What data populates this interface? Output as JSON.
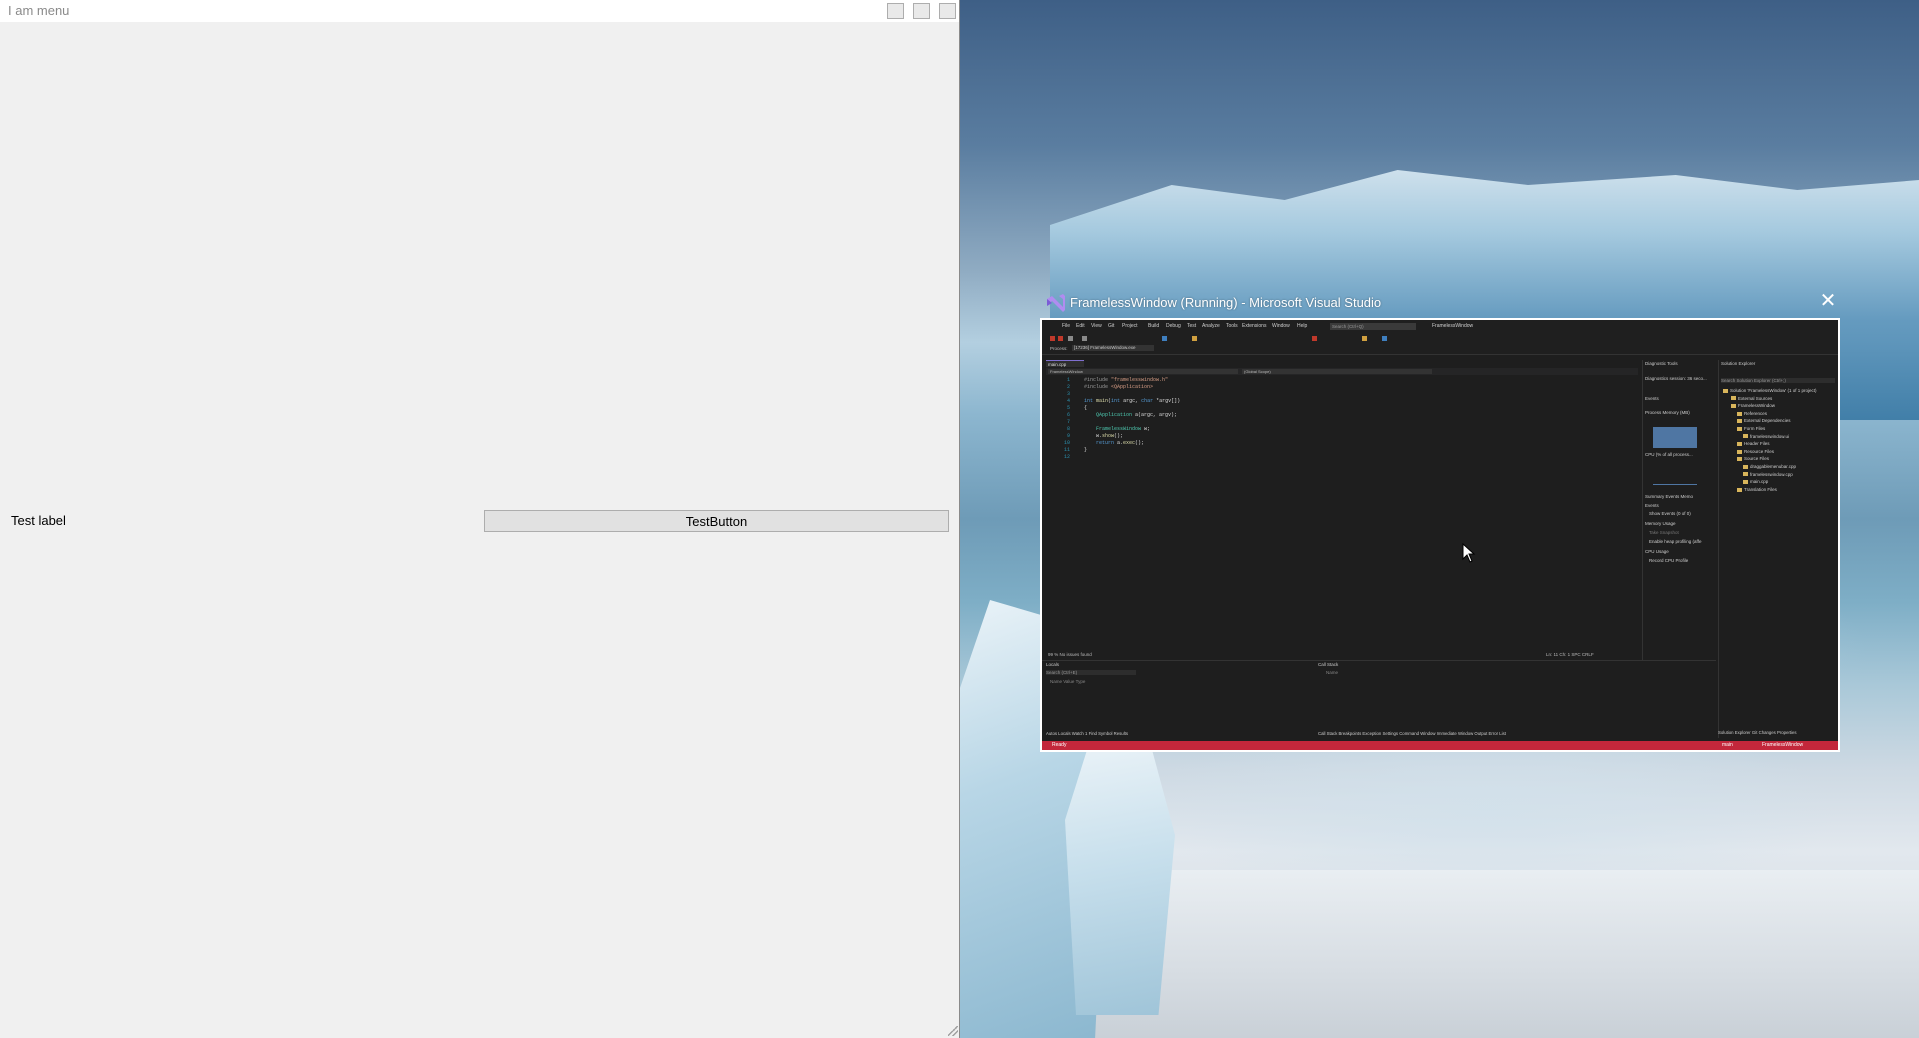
{
  "app_window": {
    "menu_title": "I am menu",
    "test_label": "Test label",
    "test_button_label": "TestButton"
  },
  "task_preview": {
    "title": "FramelessWindow (Running) - Microsoft Visual Studio",
    "close_symbol": "✕",
    "icon": "visual-studio-icon",
    "vs": {
      "menu": [
        "File",
        "Edit",
        "View",
        "Git",
        "Project",
        "Build",
        "Debug",
        "Test",
        "Analyze",
        "Tools",
        "Extensions",
        "Window",
        "Help"
      ],
      "search_placeholder": "Search (Ctrl+Q)",
      "solution_name": "FramelessWindow",
      "process_label": "Process:",
      "process_value": "[17236] FramelessWindow.exe",
      "editor_tab": "main.cpp",
      "nav_left": "FramelessWindow",
      "nav_right": "(Global Scope)",
      "code": [
        {
          "n": "1",
          "parts": [
            [
              "c-dir",
              "#include "
            ],
            [
              "c-str",
              "\"framelesswindow.h\""
            ]
          ]
        },
        {
          "n": "2",
          "parts": [
            [
              "c-dir",
              "#include "
            ],
            [
              "c-str",
              "<QApplication>"
            ]
          ]
        },
        {
          "n": "3",
          "parts": []
        },
        {
          "n": "4",
          "parts": [
            [
              "c-kw",
              "int "
            ],
            [
              "c-fn",
              "main"
            ],
            [
              "c-tx",
              "("
            ],
            [
              "c-kw",
              "int "
            ],
            [
              "c-tx",
              "argc, "
            ],
            [
              "c-kw",
              "char "
            ],
            [
              "c-tx",
              "*argv[])"
            ]
          ]
        },
        {
          "n": "5",
          "parts": [
            [
              "c-tx",
              "{"
            ]
          ]
        },
        {
          "n": "6",
          "parts": [
            [
              "c-type",
              "    QApplication "
            ],
            [
              "c-tx",
              "a(argc, argv);"
            ]
          ]
        },
        {
          "n": "7",
          "parts": []
        },
        {
          "n": "8",
          "parts": [
            [
              "c-type",
              "    FramelessWindow "
            ],
            [
              "c-tx",
              "w;"
            ]
          ]
        },
        {
          "n": "9",
          "parts": [
            [
              "c-tx",
              "    w."
            ],
            [
              "c-fn",
              "show"
            ],
            [
              "c-tx",
              "();"
            ]
          ]
        },
        {
          "n": "10",
          "parts": [
            [
              "c-kw",
              "    return "
            ],
            [
              "c-tx",
              "a."
            ],
            [
              "c-fn",
              "exec"
            ],
            [
              "c-tx",
              "();"
            ]
          ]
        },
        {
          "n": "11",
          "parts": [
            [
              "c-tx",
              "}"
            ]
          ]
        },
        {
          "n": "12",
          "parts": []
        }
      ],
      "editor_status": "99 %   No issues found",
      "editor_position": "Ln: 11   Ch: 1   SPC   CRLF",
      "diag_title": "Diagnostic Tools",
      "diag_session": "Diagnostics session: 36 seco...",
      "diag_events": "Events",
      "diag_memory": "Process Memory (MB)",
      "diag_cpu": "CPU (% of all process...",
      "diag_summary_tabs": "Summary   Events   Memo",
      "diag_show_events": "Show Events (0 of 0)",
      "diag_memory_usage": "Memory Usage",
      "diag_take_snapshot": "Take Snapshot",
      "diag_heap": "Enable heap profiling (affe",
      "diag_cpu_usage": "CPU Usage",
      "diag_record": "Record CPU Profile",
      "solution_title": "Solution Explorer",
      "solution_search": "Search Solution Explorer (Ctrl+;)",
      "solution_items": [
        "Solution 'FramelessWindow' (1 of 1 project)",
        "External Sources",
        "FramelessWindow",
        "References",
        "External Dependencies",
        "Form Files",
        "framelesswindow.ui",
        "Header Files",
        "Resource Files",
        "Source Files",
        "draggablemenubar.cpp",
        "framelesswindow.cpp",
        "main.cpp",
        "Translation Files"
      ],
      "locals_title": "Locals",
      "locals_search": "Search (Ctrl+E)",
      "locals_cols": "Name                                   Value                                   Type",
      "callstack_title": "Call Stack",
      "callstack_cols": "Name",
      "bottom_tabs_left": "Autos   Locals   Watch 1   Find Symbol Results",
      "bottom_tabs_mid": "Call Stack   Breakpoints   Exception Settings   Command Window   Immediate Window   Output   Error List",
      "bottom_tabs_right": "Solution Explorer   Git Changes   Properties",
      "status_ready": "Ready",
      "status_branch": "main",
      "status_right": "FramelessWindow"
    }
  }
}
